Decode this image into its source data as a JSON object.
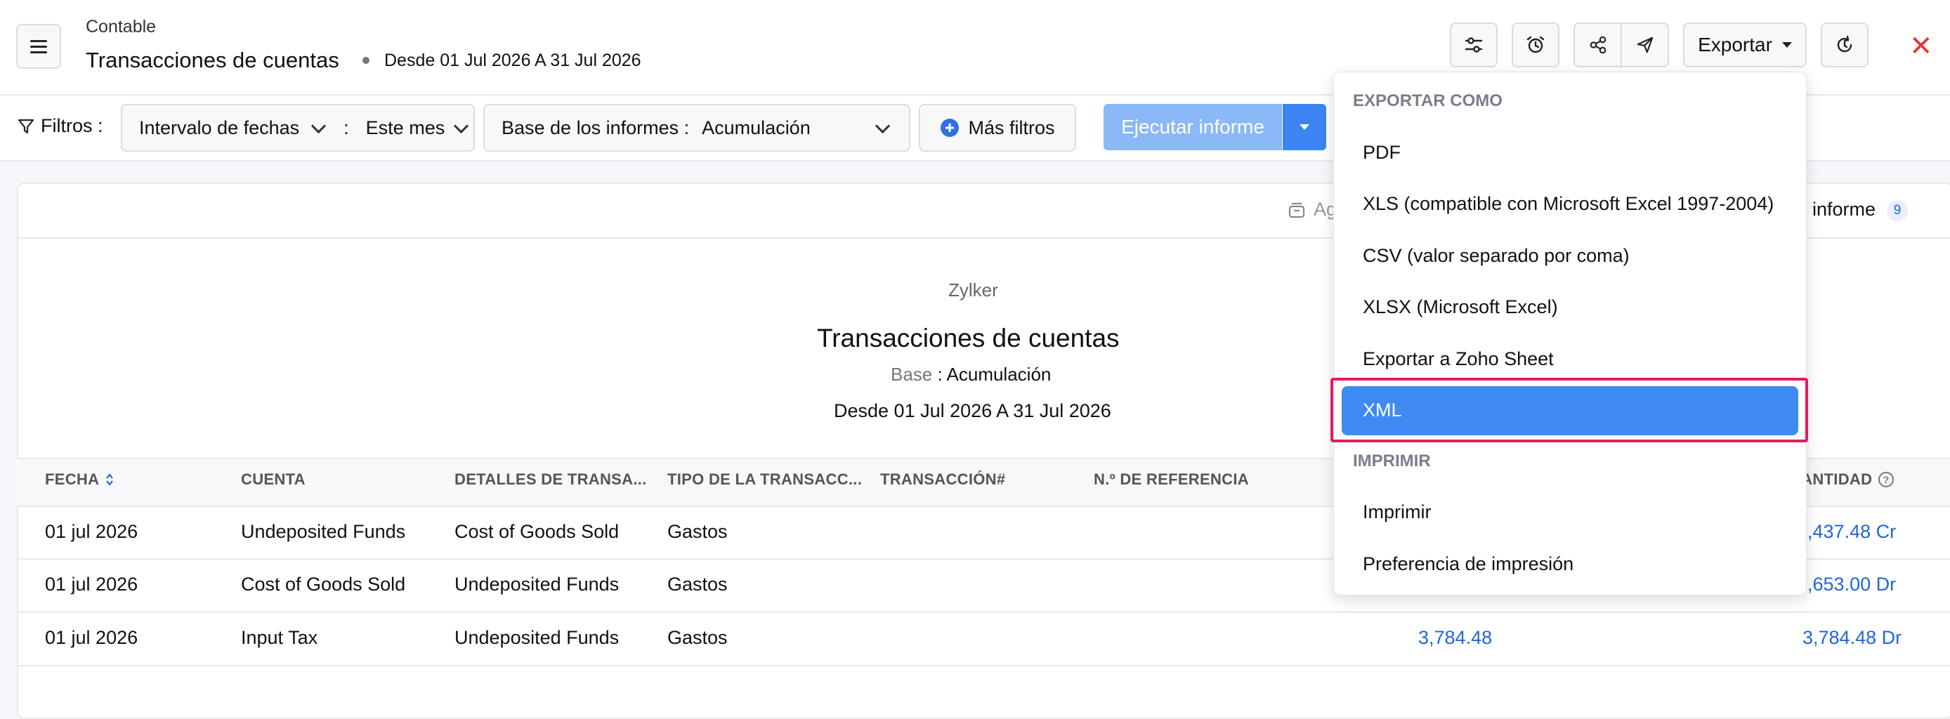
{
  "header": {
    "module": "Contable",
    "title": "Transacciones de cuentas",
    "range": "Desde 01 Jul 2026 A 31 Jul 2026",
    "export_label": "Exportar"
  },
  "filters": {
    "label": "Filtros :",
    "date_interval_label": "Intervalo de fechas",
    "separator": ":",
    "date_interval_value": "Este mes",
    "basis_label": "Base de los informes :",
    "basis_value": "Acumulación",
    "more_filters": "Más filtros",
    "run_report": "Ejecutar informe"
  },
  "toolbar": {
    "partial_left": "Ag",
    "partial_right": "informe",
    "count": "9"
  },
  "report": {
    "company": "Zylker",
    "title": "Transacciones de cuentas",
    "basis_key": "Base",
    "basis_sep": " : ",
    "basis_value": "Acumulación",
    "range": "Desde 01 Jul 2026 A 31 Jul 2026"
  },
  "table": {
    "columns": [
      "FECHA",
      "CUENTA",
      "DETALLES DE TRANSA...",
      "TIPO DE LA TRANSACC...",
      "TRANSACCIÓN#",
      "N.º DE REFERENCIA",
      "CANTIDAD"
    ],
    "rows": [
      {
        "fecha": "01 jul 2026",
        "cuenta": "Undeposited Funds",
        "detalles": "Cost of Goods Sold",
        "tipo": "Gastos",
        "mid": "",
        "cantidad": "7,437.48 Cr"
      },
      {
        "fecha": "01 jul 2026",
        "cuenta": "Cost of Goods Sold",
        "detalles": "Undeposited Funds",
        "tipo": "Gastos",
        "mid": "",
        "cantidad": "3,653.00 Dr"
      },
      {
        "fecha": "01 jul 2026",
        "cuenta": "Input Tax",
        "detalles": "Undeposited Funds",
        "tipo": "Gastos",
        "mid": "3,784.48",
        "cantidad": "3,784.48 Dr"
      }
    ]
  },
  "export_menu": {
    "section_export": "EXPORTAR COMO",
    "options": [
      "PDF",
      "XLS (compatible con Microsoft Excel 1997-2004)",
      "CSV (valor separado por coma)",
      "XLSX (Microsoft Excel)",
      "Exportar a Zoho Sheet",
      "XML"
    ],
    "section_print": "IMPRIMIR",
    "print_options": [
      "Imprimir",
      "Preferencia de impresión"
    ],
    "selected": "XML"
  },
  "colors": {
    "accent": "#408af5",
    "highlight_frame": "#e8195e",
    "link_blue": "#2166d9",
    "close_red": "#e5393b"
  }
}
